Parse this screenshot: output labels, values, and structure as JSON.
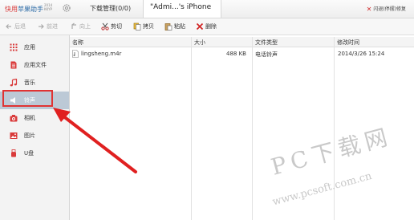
{
  "titlebar": {
    "brand_part1": "快用",
    "brand_part2": "苹果助手",
    "brand_ver_line1": "2014",
    "brand_ver_line2": "KKYP",
    "download_label": "下载管理(0/0)",
    "device_tab": "\"Admi...'s iPhone",
    "flash_label": "闪退(停摆)修复"
  },
  "toolbar": {
    "back": "后退",
    "forward": "前进",
    "up": "向上",
    "cut": "剪切",
    "copy": "拷贝",
    "paste": "粘贴",
    "delete": "删除"
  },
  "sidebar": {
    "items": [
      {
        "label": "应用",
        "icon": "grid-icon"
      },
      {
        "label": "应用文件",
        "icon": "file-icon"
      },
      {
        "label": "音乐",
        "icon": "music-note-icon"
      },
      {
        "label": "铃声",
        "icon": "speaker-icon",
        "selected": true
      },
      {
        "label": "相机",
        "icon": "camera-icon"
      },
      {
        "label": "图片",
        "icon": "picture-icon"
      },
      {
        "label": "U盘",
        "icon": "usb-icon"
      }
    ]
  },
  "table": {
    "columns": [
      "名称",
      "大小",
      "文件类型",
      "修改时间"
    ],
    "rows": [
      {
        "name": "lingsheng.m4r",
        "size": "488 KB",
        "type": "电话铃声",
        "modified": "2014/3/26 15:24"
      }
    ]
  },
  "watermark": {
    "main": "PC下载网",
    "sub": "www.pcsoft.com.cn"
  },
  "colors": {
    "accent_red": "#e03333",
    "selected_bg": "#bcc9d6",
    "icon_red": "#d93a3a"
  }
}
